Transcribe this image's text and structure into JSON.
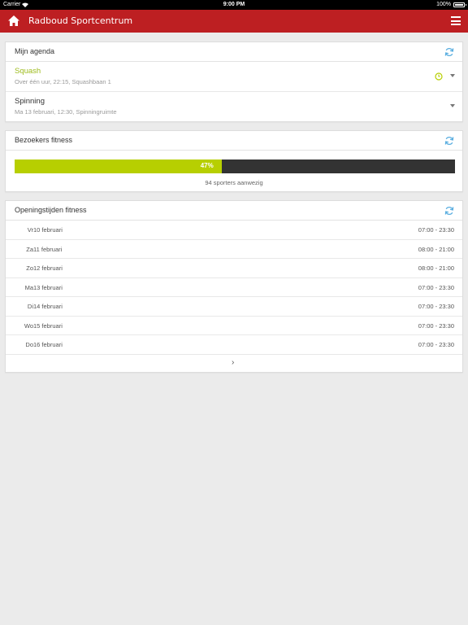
{
  "status_bar": {
    "carrier": "Carrier",
    "time": "9:00 PM",
    "battery": "100%"
  },
  "header": {
    "title": "Radboud Sportcentrum"
  },
  "colors": {
    "brand": "#bd1f22",
    "accent": "#b7cf01",
    "refresh": "#5aaee0"
  },
  "agenda": {
    "title": "Mijn agenda",
    "items": [
      {
        "name": "Squash",
        "detail": "Over één uur, 22:15, Squashbaan 1",
        "highlight": true
      },
      {
        "name": "Spinning",
        "detail": "Ma 13 februari, 12:30, Spinningruimte",
        "highlight": false
      }
    ]
  },
  "fitness": {
    "title": "Bezoekers fitness",
    "occupancy_percent": 47,
    "percent_label": "47%",
    "visitors_text": "94 sporters aanwezig"
  },
  "hours": {
    "title": "Openingstijden fitness",
    "rows": [
      {
        "day": "Vr",
        "date": "10 februari",
        "hours": "07:00 - 23:30"
      },
      {
        "day": "Za",
        "date": "11 februari",
        "hours": "08:00 - 21:00"
      },
      {
        "day": "Zo",
        "date": "12 februari",
        "hours": "08:00 - 21:00"
      },
      {
        "day": "Ma",
        "date": "13 februari",
        "hours": "07:00 - 23:30"
      },
      {
        "day": "Di",
        "date": "14 februari",
        "hours": "07:00 - 23:30"
      },
      {
        "day": "Wo",
        "date": "15 februari",
        "hours": "07:00 - 23:30"
      },
      {
        "day": "Do",
        "date": "16 februari",
        "hours": "07:00 - 23:30"
      }
    ],
    "next_label": "›"
  }
}
